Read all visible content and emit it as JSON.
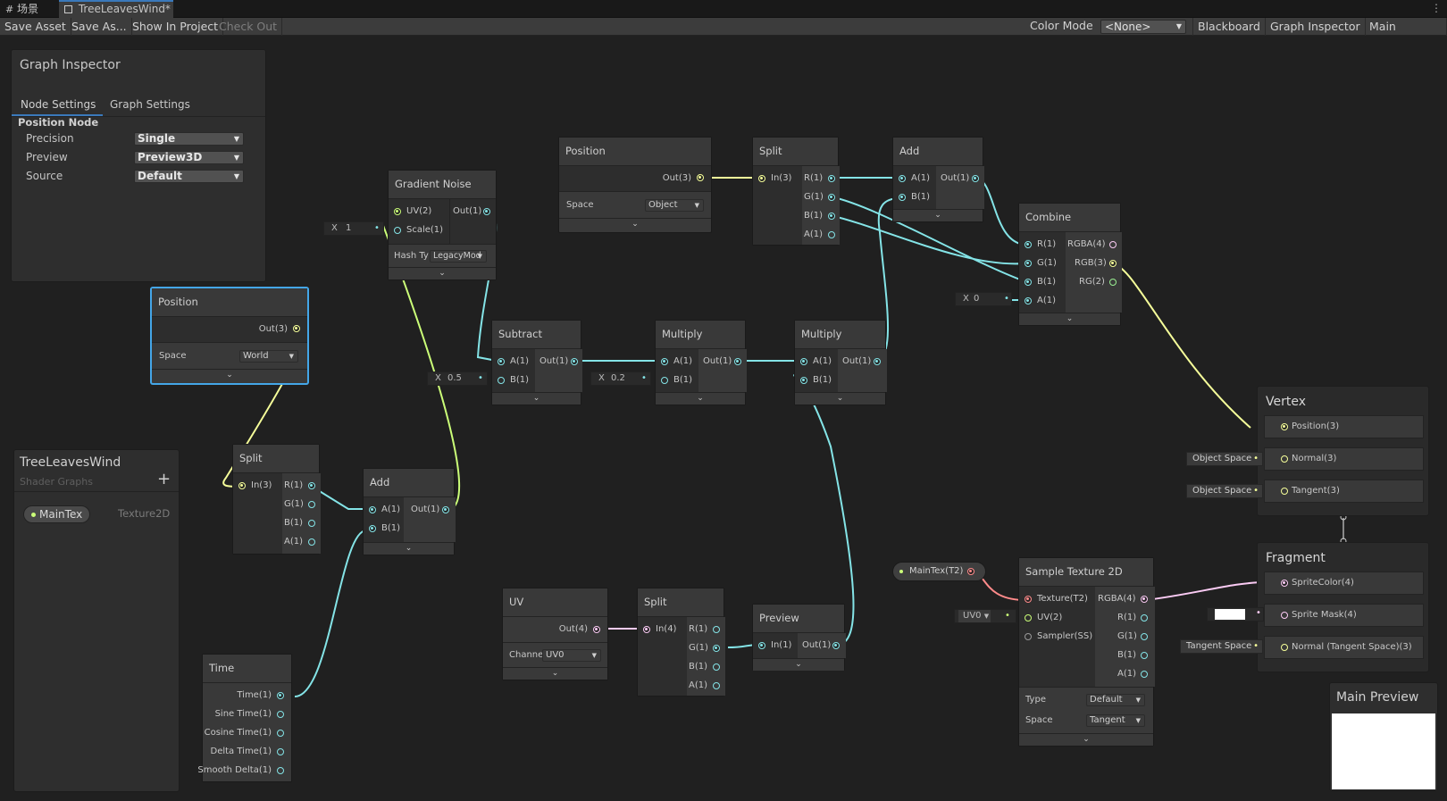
{
  "tabs": [
    {
      "label": "场景"
    },
    {
      "label": "TreeLeavesWind*"
    }
  ],
  "toolbar": {
    "save_asset": "Save Asset",
    "save_as": "Save As...",
    "show_in_project": "Show In Project",
    "check_out": "Check Out",
    "color_mode_label": "Color Mode",
    "color_mode_value": "<None>",
    "blackboard": "Blackboard",
    "graph_inspector": "Graph Inspector",
    "main_preview": "Main Preview"
  },
  "inspector": {
    "title": "Graph Inspector",
    "tab_node": "Node Settings",
    "tab_graph": "Graph Settings",
    "section": "Position Node",
    "rows": [
      {
        "label": "Precision",
        "value": "Single"
      },
      {
        "label": "Preview",
        "value": "Preview3D"
      },
      {
        "label": "Source",
        "value": "Default"
      }
    ]
  },
  "blackboard": {
    "title": "TreeLeavesWind",
    "subtitle": "Shader Graphs",
    "add": "+",
    "property": {
      "name": "MainTex",
      "type": "Texture2D"
    }
  },
  "nodes": {
    "position_world": {
      "title": "Position",
      "out": "Out(3)",
      "space_label": "Space",
      "space_value": "World"
    },
    "gradient_noise": {
      "title": "Gradient Noise",
      "uv": "UV(2)",
      "scale": "Scale(1)",
      "out": "Out(1)",
      "hash_label": "Hash Ty",
      "hash_value": "LegacyMod",
      "scale_input_label": "X",
      "scale_input_value": "1"
    },
    "position_object": {
      "title": "Position",
      "out": "Out(3)",
      "space_label": "Space",
      "space_value": "Object"
    },
    "split_top": {
      "title": "Split",
      "in": "In(3)",
      "r": "R(1)",
      "g": "G(1)",
      "b": "B(1)",
      "a": "A(1)"
    },
    "add_top": {
      "title": "Add",
      "a": "A(1)",
      "b": "B(1)",
      "out": "Out(1)"
    },
    "combine": {
      "title": "Combine",
      "r": "R(1)",
      "g": "G(1)",
      "b": "B(1)",
      "a": "A(1)",
      "rgba": "RGBA(4)",
      "rgb": "RGB(3)",
      "rg": "RG(2)",
      "a_input_label": "X",
      "a_input_value": "0"
    },
    "subtract": {
      "title": "Subtract",
      "a": "A(1)",
      "b": "B(1)",
      "out": "Out(1)",
      "b_input_label": "X",
      "b_input_value": "0.5"
    },
    "multiply1": {
      "title": "Multiply",
      "a": "A(1)",
      "b": "B(1)",
      "out": "Out(1)",
      "b_input_label": "X",
      "b_input_value": "0.2"
    },
    "multiply2": {
      "title": "Multiply",
      "a": "A(1)",
      "b": "B(1)",
      "out": "Out(1)"
    },
    "split_left": {
      "title": "Split",
      "in": "In(3)",
      "r": "R(1)",
      "g": "G(1)",
      "b": "B(1)",
      "a": "A(1)"
    },
    "add_left": {
      "title": "Add",
      "a": "A(1)",
      "b": "B(1)",
      "out": "Out(1)"
    },
    "time": {
      "title": "Time",
      "outs": [
        "Time(1)",
        "Sine Time(1)",
        "Cosine Time(1)",
        "Delta Time(1)",
        "Smooth Delta(1)"
      ]
    },
    "uv": {
      "title": "UV",
      "out": "Out(4)",
      "channel_label": "Channe",
      "channel_value": "UV0"
    },
    "split_bottom": {
      "title": "Split",
      "in": "In(4)",
      "r": "R(1)",
      "g": "G(1)",
      "b": "B(1)",
      "a": "A(1)"
    },
    "preview": {
      "title": "Preview",
      "in": "In(1)",
      "out": "Out(1)"
    },
    "maintex_prop": {
      "label": "MainTex(T2)"
    },
    "sample_texture": {
      "title": "Sample Texture 2D",
      "texture": "Texture(T2)",
      "uv": "UV(2)",
      "sampler": "Sampler(SS)",
      "rgba": "RGBA(4)",
      "r": "R(1)",
      "g": "G(1)",
      "b": "B(1)",
      "a": "A(1)",
      "type_label": "Type",
      "type_value": "Default",
      "space_label": "Space",
      "space_value": "Tangent",
      "uv_input": "UV0"
    }
  },
  "vertex": {
    "title": "Vertex",
    "slots": [
      "Position(3)",
      "Normal(3)",
      "Tangent(3)"
    ],
    "normal_tag": "Object Space",
    "tangent_tag": "Object Space"
  },
  "fragment": {
    "title": "Fragment",
    "slots": [
      "SpriteColor(4)",
      "Sprite Mask(4)",
      "Normal (Tangent Space)(3)"
    ],
    "normal_tag": "Tangent Space"
  },
  "main_preview": {
    "title": "Main Preview"
  },
  "colors": {
    "float": "#84e4e7",
    "vector3": "#f6ff9a",
    "vector4": "#fbcbf4",
    "texture": "#ff8b8b",
    "uv": "#cbfe78",
    "accent": "#3a79bb"
  }
}
